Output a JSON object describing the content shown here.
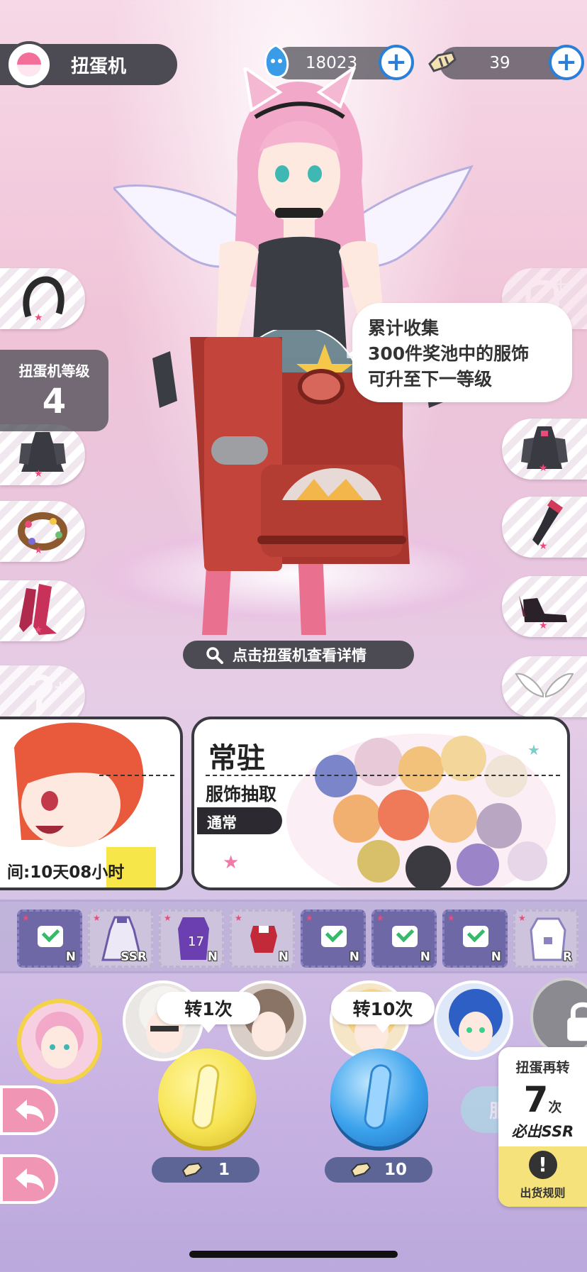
{
  "header": {
    "title": "扭蛋机",
    "gem_count": "18023",
    "ticket_count": "39"
  },
  "level": {
    "label": "扭蛋机等级",
    "value": "4"
  },
  "bubble": {
    "line1": "累计收集",
    "line2": "300件奖池中的服饰",
    "line3": "可升至下一等级"
  },
  "hint": "点击扭蛋机查看详情",
  "banners": {
    "left_time": "间:10天08小时",
    "main_title": "常驻",
    "main_sub": "服饰抽取",
    "main_tag": "通常"
  },
  "prizes": [
    {
      "rarity": "N",
      "owned": true
    },
    {
      "rarity": "SSR",
      "owned": false
    },
    {
      "rarity": "N",
      "owned": false
    },
    {
      "rarity": "N",
      "owned": false
    },
    {
      "rarity": "N",
      "owned": true
    },
    {
      "rarity": "N",
      "owned": true
    },
    {
      "rarity": "N",
      "owned": true
    },
    {
      "rarity": "R",
      "owned": false
    }
  ],
  "spin": {
    "once_label": "转1次",
    "ten_label": "转10次",
    "once_cost": "1",
    "ten_cost": "10"
  },
  "pity": {
    "line1": "扭蛋再转",
    "count": "7",
    "unit": "次",
    "line2": "必出SSR",
    "rules": "出货规则"
  },
  "faded_button": "服饰",
  "colors": {
    "yellow_button": "#f7e453",
    "blue_button": "#3ba2ec",
    "dark_pill": "#4c4a52",
    "accent_pink": "#e94c7b"
  }
}
